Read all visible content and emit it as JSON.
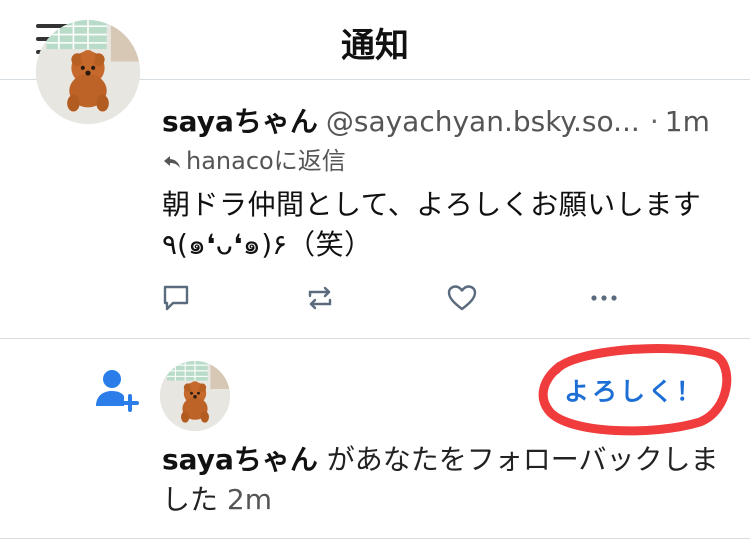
{
  "header": {
    "title": "通知"
  },
  "post": {
    "display_name": "sayaちゃん",
    "handle": "@sayachyan.bsky.so...",
    "separator": "·",
    "time": "1m",
    "reply_to": "hanacoに返信",
    "text": "朝ドラ仲間として、よろしくお願いします٩(๑❛ᴗ❛๑)۶（笑）"
  },
  "follow_notification": {
    "display_name": "sayaちゃん",
    "message": " があなたをフォローバックしました ",
    "time": "2m",
    "sticker_text": "よろしく！"
  },
  "icons": {
    "menu": "menu-icon",
    "reply_arrow": "reply-arrow-icon",
    "comment": "comment-icon",
    "repost": "repost-icon",
    "like": "heart-icon",
    "more": "more-icon",
    "follow": "person-add-icon"
  },
  "colors": {
    "accent": "#1d6fd6",
    "follow_icon": "#2b7de9",
    "sticker_circle": "#ef2b2b",
    "divider": "#d5dde3"
  }
}
